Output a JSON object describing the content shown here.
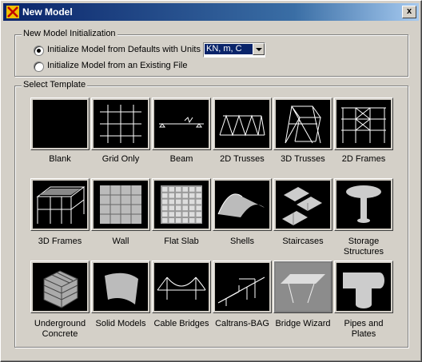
{
  "window": {
    "title": "New Model",
    "close_label": "x"
  },
  "init_group": {
    "legend": "New Model Initialization",
    "option_defaults_label": "Initialize Model from Defaults with Units",
    "option_file_label": "Initialize Model  from an Existing File",
    "selected_option": "defaults",
    "units_value": "KN, m, C"
  },
  "template_group": {
    "legend": "Select Template",
    "templates": [
      {
        "label": "Blank",
        "icon": "blank-icon"
      },
      {
        "label": "Grid Only",
        "icon": "grid-only-icon"
      },
      {
        "label": "Beam",
        "icon": "beam-icon"
      },
      {
        "label": "2D Trusses",
        "icon": "2d-trusses-icon"
      },
      {
        "label": "3D Trusses",
        "icon": "3d-trusses-icon"
      },
      {
        "label": "2D Frames",
        "icon": "2d-frames-icon"
      },
      {
        "label": "3D Frames",
        "icon": "3d-frames-icon"
      },
      {
        "label": "Wall",
        "icon": "wall-icon"
      },
      {
        "label": "Flat Slab",
        "icon": "flat-slab-icon"
      },
      {
        "label": "Shells",
        "icon": "shells-icon"
      },
      {
        "label": "Staircases",
        "icon": "staircases-icon"
      },
      {
        "label": "Storage Structures",
        "icon": "storage-structures-icon"
      },
      {
        "label": "Underground Concrete",
        "icon": "underground-concrete-icon"
      },
      {
        "label": "Solid Models",
        "icon": "solid-models-icon"
      },
      {
        "label": "Cable Bridges",
        "icon": "cable-bridges-icon"
      },
      {
        "label": "Caltrans-BAG",
        "icon": "caltrans-bag-icon"
      },
      {
        "label": "Bridge Wizard",
        "icon": "bridge-wizard-icon",
        "selected": true
      },
      {
        "label": "Pipes and Plates",
        "icon": "pipes-and-plates-icon"
      }
    ]
  }
}
